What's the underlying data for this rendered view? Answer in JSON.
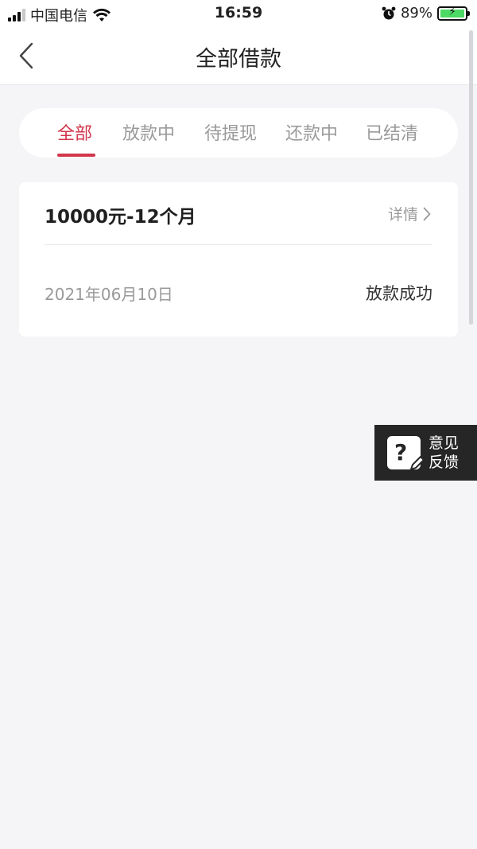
{
  "status_bar": {
    "carrier": "中国电信",
    "time": "16:59",
    "battery_percent": "89%",
    "icons": [
      "signal-icon",
      "wifi-icon",
      "alarm-icon",
      "battery-icon"
    ]
  },
  "nav": {
    "title": "全部借款",
    "back_icon": "chevron-left-icon"
  },
  "tabs": [
    {
      "label": "全部",
      "active": true
    },
    {
      "label": "放款中",
      "active": false
    },
    {
      "label": "待提现",
      "active": false
    },
    {
      "label": "还款中",
      "active": false
    },
    {
      "label": "已结清",
      "active": false
    }
  ],
  "loans": [
    {
      "title": "10000元-12个月",
      "detail_label": "详情",
      "date": "2021年06月10日",
      "status": "放款成功"
    }
  ],
  "feedback": {
    "icon": "question-edit-icon",
    "line1": "意见",
    "line2": "反馈"
  },
  "colors": {
    "accent": "#d2364b",
    "background": "#f5f5f7",
    "feedback_bg": "#262626"
  }
}
